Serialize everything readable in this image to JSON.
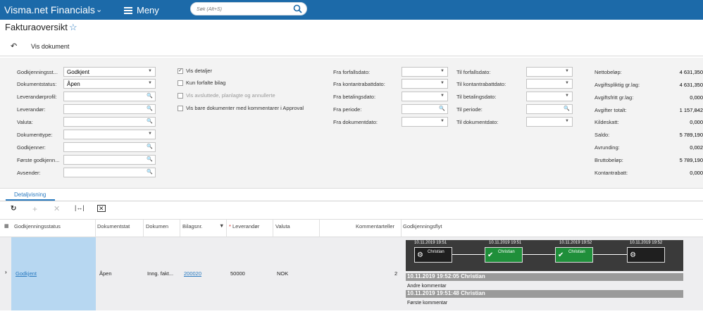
{
  "app": {
    "brand": "Visma.net Financials",
    "menu": "Meny",
    "search_placeholder": "Søk (Alt+S)"
  },
  "page": {
    "title": "Fakturaoversikt"
  },
  "toolbar": {
    "vis_dokument": "Vis dokument"
  },
  "filters": {
    "godkjenningsstatus_label": "Godkjenningsst...",
    "godkjenningsstatus": "Godkjent",
    "dokumentstatus_label": "Dokumentstatus:",
    "dokumentstatus": "Åpen",
    "leverandorprofil_label": "Leverandørprofil:",
    "leverandor_label": "Leverandør:",
    "valuta_label": "Valuta:",
    "dokumenttype_label": "Dokumenttype:",
    "godkjenner_label": "Godkjenner:",
    "forste_godkjenner_label": "Første godkjenn...",
    "avsender_label": "Avsender:"
  },
  "checks": {
    "vis_detaljer": "Vis detaljer",
    "kun_forfalte": "Kun forfalte bilag",
    "vis_avsluttede": "Vis avsluttede, planlagte og annullerte",
    "vis_bare": "Vis bare dokumenter med kommentarer i Approval"
  },
  "dates": {
    "fra_forfallsdato": "Fra forfallsdato:",
    "fra_kontantrabattdato": "Fra kontantrabattdato:",
    "fra_betalingsdato": "Fra betalingsdato:",
    "fra_periode": "Fra periode:",
    "fra_dokumentdato": "Fra dokumentdato:",
    "til_forfallsdato": "Til forfallsdato:",
    "til_kontantrabattdato": "Til kontantrabattdato:",
    "til_betalingsdato": "Til betalingsdato:",
    "til_periode": "Til periode:",
    "til_dokumentdato": "Til dokumentdato:"
  },
  "summary": [
    {
      "label": "Nettobeløp:",
      "value": "4 631,350"
    },
    {
      "label": "Avgiftspliktig gr.lag:",
      "value": "4 631,350"
    },
    {
      "label": "Avgiftsfritt gr.lag:",
      "value": "0,000"
    },
    {
      "label": "Avgifter totalt:",
      "value": "1 157,842"
    },
    {
      "label": "Kildeskatt:",
      "value": "0,000"
    },
    {
      "label": "Saldo:",
      "value": "5 789,190"
    },
    {
      "label": "Avrunding:",
      "value": "0,002"
    },
    {
      "label": "Bruttobeløp:",
      "value": "5 789,190"
    },
    {
      "label": "Kontantrabatt:",
      "value": "0,000"
    }
  ],
  "tabs": {
    "detaljvisning": "Detaljvisning"
  },
  "grid": {
    "headers": {
      "godkjenningsstatus": "Godkjenningsstatus",
      "dokumentstat": "Dokumentstat",
      "dokumen": "Dokumen",
      "bilagsnr": "Bilagsnr.",
      "leverandor": "Leverandør",
      "valuta": "Valuta",
      "kommentarteller": "Kommentarteller",
      "godkjenningsflyt": "Godkjenningsflyt"
    },
    "row": {
      "godkjenningsstatus": "Godkjent",
      "dokumentstat": "Åpen",
      "dokumen": "Inng. fakt...",
      "bilagsnr": "200020",
      "leverandor": "50000",
      "valuta": "NOK",
      "kommentarteller": "2"
    }
  },
  "flow": {
    "nodes": [
      {
        "ts": "10.11.2019 19:51",
        "name": "Christian"
      },
      {
        "ts": "10.11.2019 19:51",
        "name": "Christian"
      },
      {
        "ts": "10.11.2019 19:52",
        "name": "Christian"
      },
      {
        "ts": "10.11.2019 19:52",
        "name": ""
      }
    ],
    "comments": [
      {
        "header": "10.11.2019 19:52:05 Christian",
        "text": "Andre kommentar"
      },
      {
        "header": "10.11.2019 19:51:48 Christian",
        "text": "Første kommentar"
      }
    ]
  }
}
